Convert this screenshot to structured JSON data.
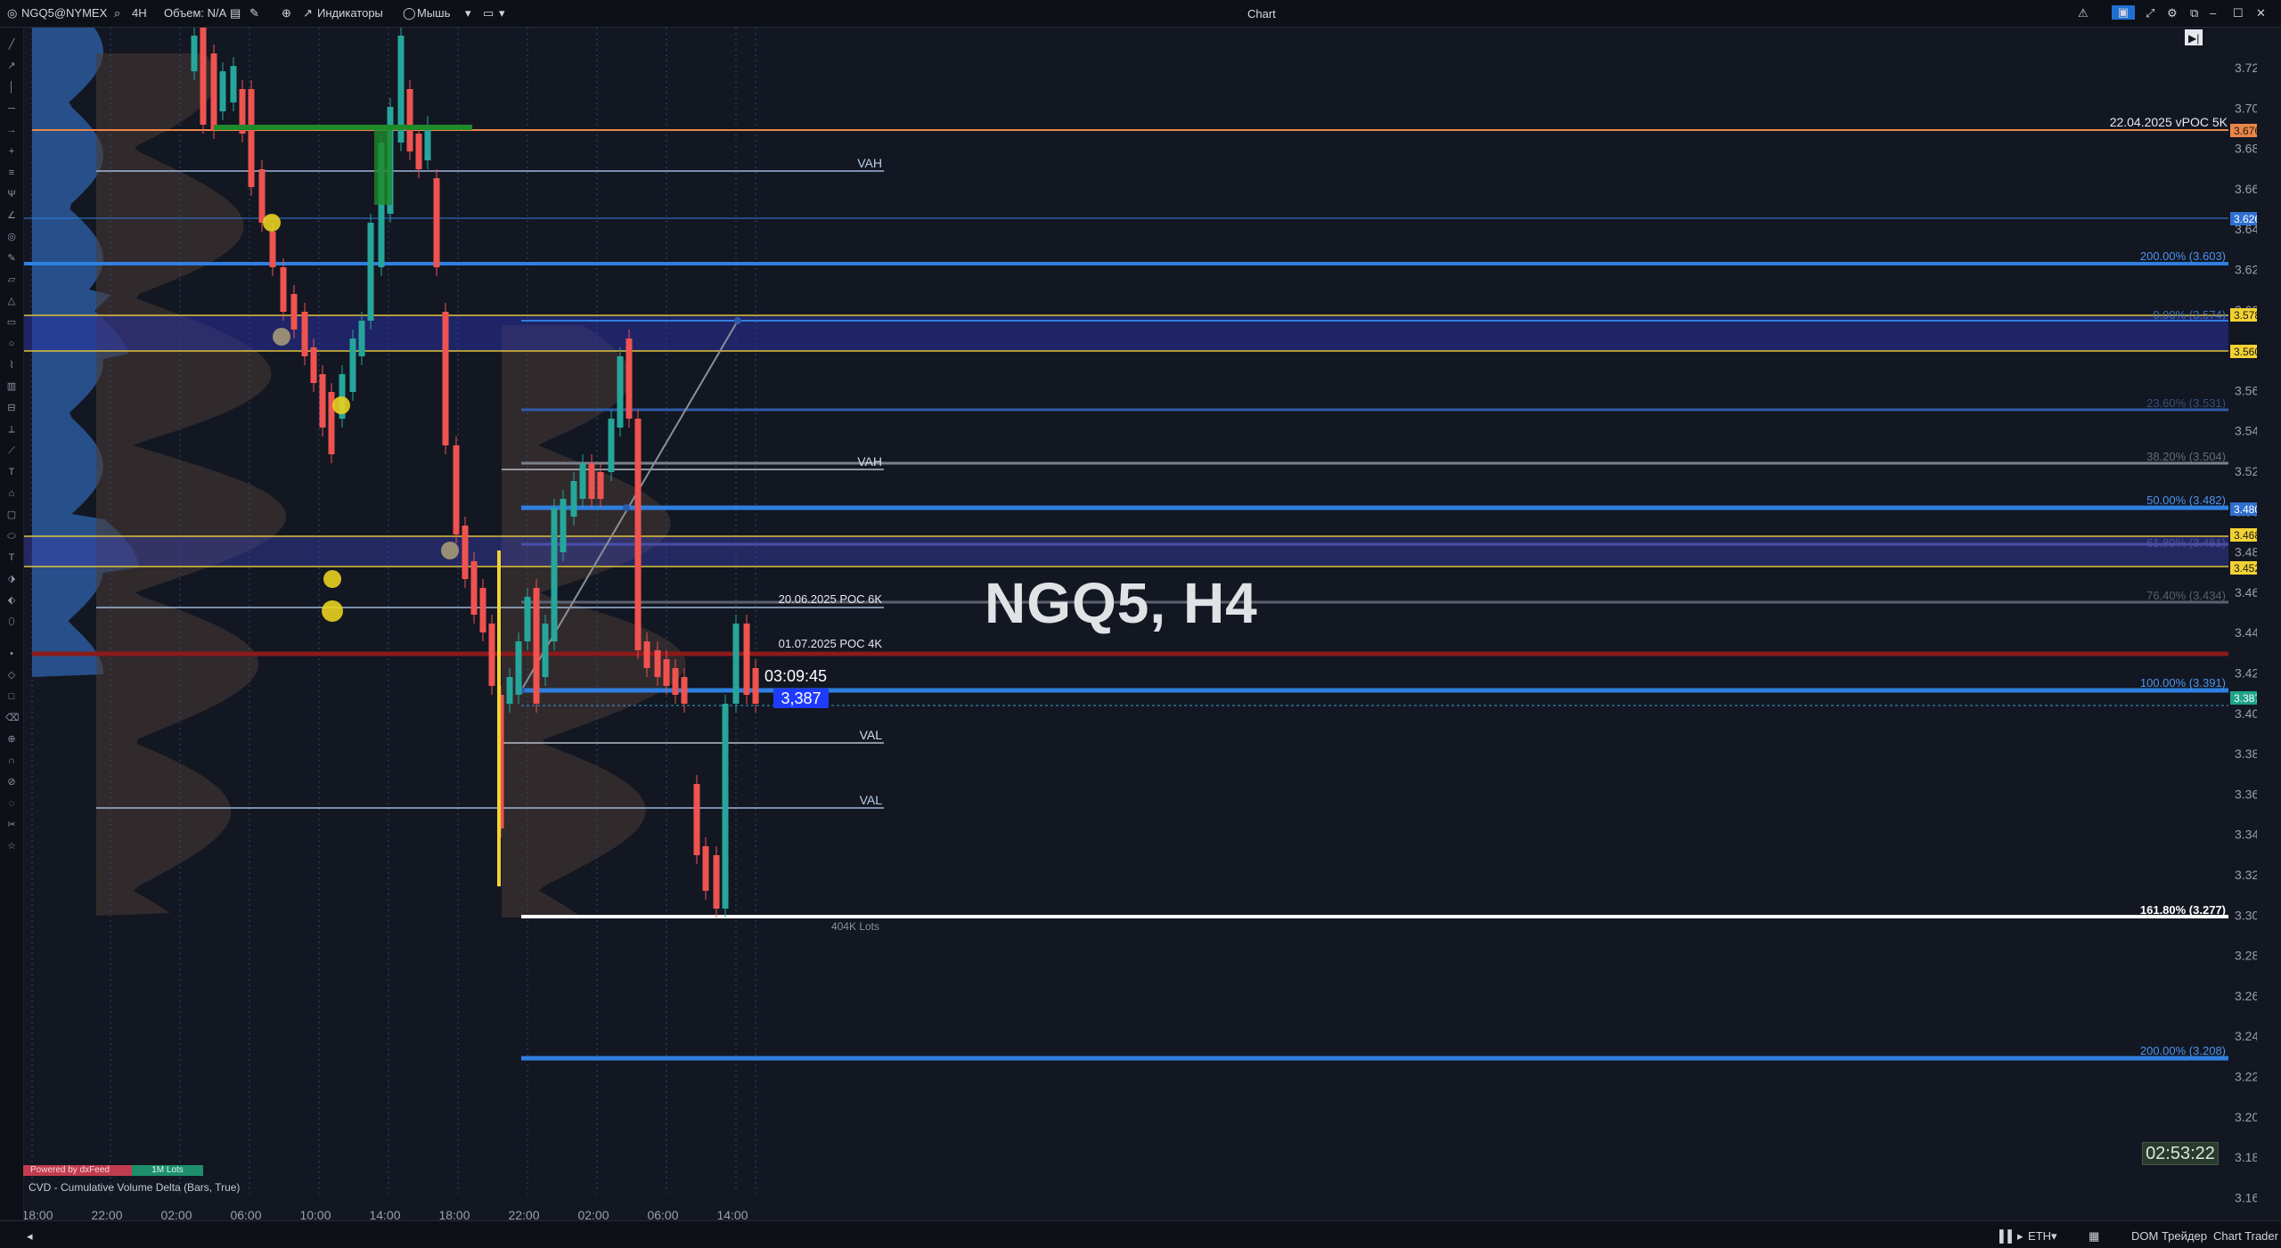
{
  "topbar": {
    "symbol": "NGQ5@NYMEX",
    "timeframe": "4H",
    "volume_label": "Объем: N/A",
    "indicators_label": "Индикаторы",
    "cursor_mode": "Мышь",
    "window_title": "Chart"
  },
  "chart": {
    "title": "NGQ5, H4",
    "countdown": "03:09:45",
    "current_price": "3,387",
    "bar_timer": "02:53:22",
    "cvd_label": "CVD - Cumulative Volume Delta (Bars, True)",
    "powered_label": "Powered by dxFeed",
    "lots_badge": "1M Lots",
    "lots_small": "404K Lots",
    "level_labels": {
      "vpoc_22_04": "22.04.2025 vPOC 5K",
      "vah_top": "VAH",
      "vah_mid": "VAH",
      "poc_20_06": "20.06.2025 POC 6K",
      "poc_01_07": "01.07.2025 POC 4K",
      "val_1": "VAL",
      "val_2": "VAL"
    },
    "fib_labels": {
      "f200_up": "200.00% (3.603)",
      "f0": "0.00% (3.574)",
      "f236": "23.60% (3.531)",
      "f382": "38.20% (3.504)",
      "f50": "50.00% (3.482)",
      "f618": "61.80% (3.461)",
      "f764": "76.40% (3.434)",
      "f100": "100.00% (3.391)",
      "f1618": "161.80% (3.277)",
      "f200_dn": "200.00% (3.208)"
    },
    "price_badges": {
      "p3676": "3.676",
      "p3626": "3.626",
      "p3578": "3.578",
      "p3560": "3.560",
      "p3480": "3.480",
      "p3468": "3.468",
      "p3452": "3.452",
      "p3387": "3.387"
    },
    "price_axis": [
      "3.720",
      "3.700",
      "3.680",
      "3.660",
      "3.640",
      "3.620",
      "3.600",
      "3.580",
      "3.560",
      "3.540",
      "3.520",
      "3.500",
      "3.480",
      "3.460",
      "3.440",
      "3.420",
      "3.400",
      "3.380",
      "3.360",
      "3.340",
      "3.320",
      "3.300",
      "3.280",
      "3.260",
      "3.240",
      "3.220",
      "3.200",
      "3.180",
      "3.160"
    ],
    "time_axis": [
      "18:00",
      "22:00",
      "02:00",
      "06:00",
      "10:00",
      "14:00",
      "18:00",
      "22:00",
      "02:00",
      "06:00",
      "14:00"
    ]
  },
  "colors": {
    "background": "#131722",
    "bull": "#26a69a",
    "bear": "#ef5350",
    "fib_blue": "#2f7fe0",
    "zone": "#2a2f9e",
    "poc_red": "#8b1a1a"
  },
  "bottombar": {
    "session": "ETH",
    "dom_trader": "DOM Трейдер",
    "chart_trader": "Chart Trader"
  }
}
